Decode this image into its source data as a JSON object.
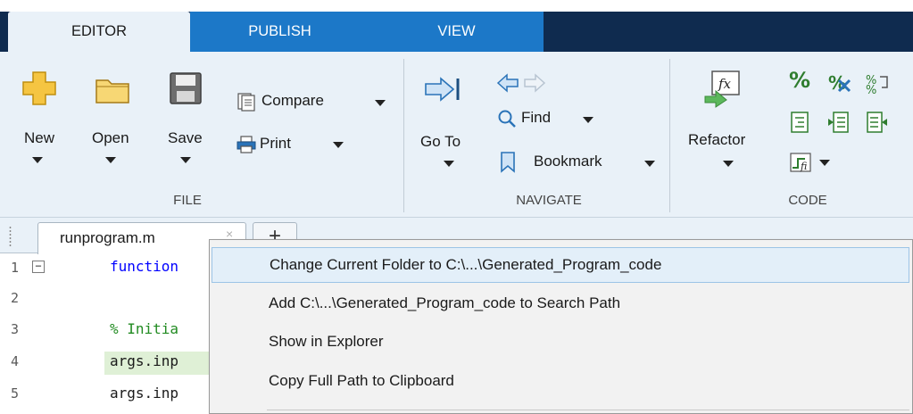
{
  "tabs": [
    {
      "label": "EDITOR",
      "active": true
    },
    {
      "label": "PUBLISH",
      "active": false
    },
    {
      "label": "VIEW",
      "active": false
    }
  ],
  "ribbon": {
    "file": {
      "section_label": "FILE",
      "new_label": "New",
      "open_label": "Open",
      "save_label": "Save",
      "compare_label": "Compare",
      "print_label": "Print"
    },
    "navigate": {
      "section_label": "NAVIGATE",
      "goto_label": "Go To",
      "find_label": "Find",
      "bookmark_label": "Bookmark"
    },
    "code": {
      "section_label": "CODE",
      "refactor_label": "Refactor",
      "percent_symbol": "%",
      "fx_symbol": "fx"
    }
  },
  "editor": {
    "file_tab": "runprogram.m",
    "close_glyph": "×",
    "plus_glyph": "+",
    "line_numbers": [
      "1",
      "2",
      "3",
      "4",
      "5"
    ],
    "fold_glyph": "−",
    "lines": [
      {
        "text": "function",
        "kind": "kw"
      },
      {
        "text": "",
        "kind": "tx"
      },
      {
        "text": "% Initia",
        "kind": "cm"
      },
      {
        "text": "args.inp",
        "kind": "tx"
      },
      {
        "text": "args.inp",
        "kind": "tx"
      }
    ]
  },
  "context_menu": {
    "items": [
      {
        "label": "Change Current Folder to C:\\...\\Generated_Program_code",
        "selected": true
      },
      {
        "label": "Add C:\\...\\Generated_Program_code to Search Path",
        "selected": false
      },
      {
        "label": "Show in Explorer",
        "selected": false
      },
      {
        "label": "Copy Full Path to Clipboard",
        "selected": false
      }
    ]
  },
  "colors": {
    "tab_navy": "#0f2b4f",
    "tab_blue": "#1c78c8",
    "ribbon_bg": "#e9f1f8",
    "menu_selected": "#e3eff9",
    "keyword": "#0000ff",
    "comment": "#228b22"
  }
}
